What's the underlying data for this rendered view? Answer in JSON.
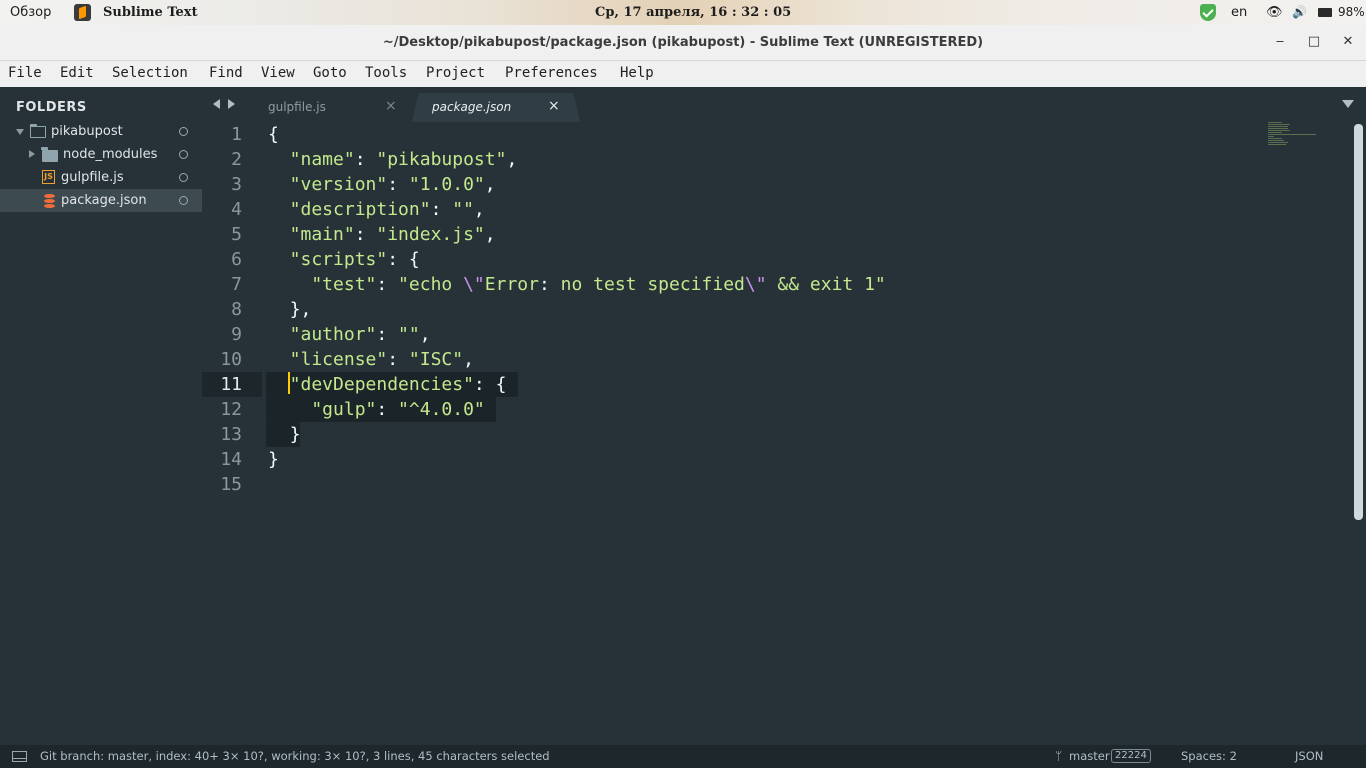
{
  "topbar": {
    "overview": "Обзор",
    "app_name": "Sublime Text",
    "clock": "Ср, 17 апреля, 16 : 32 : 05",
    "language": "en",
    "battery": "98%"
  },
  "window": {
    "title": "~/Desktop/pikabupost/package.json (pikabupost) - Sublime Text (UNREGISTERED)",
    "minimize": "‒",
    "maximize": "□",
    "close": "✕"
  },
  "menu": [
    "File",
    "Edit",
    "Selection",
    "Find",
    "View",
    "Goto",
    "Tools",
    "Project",
    "Preferences",
    "Help"
  ],
  "sidebar": {
    "heading": "FOLDERS",
    "items": [
      {
        "label": "pikabupost",
        "type": "folder-open"
      },
      {
        "label": "node_modules",
        "type": "folder"
      },
      {
        "label": "gulpfile.js",
        "type": "js"
      },
      {
        "label": "package.json",
        "type": "json"
      }
    ]
  },
  "tabs": [
    {
      "label": "gulpfile.js",
      "active": false
    },
    {
      "label": "package.json",
      "active": true
    }
  ],
  "editor": {
    "current_line": 11,
    "line_numbers": [
      "1",
      "2",
      "3",
      "4",
      "5",
      "6",
      "7",
      "8",
      "9",
      "10",
      "11",
      "12",
      "13",
      "14",
      "15"
    ],
    "code_lines": [
      "{",
      "  \"name\": \"pikabupost\",",
      "  \"version\": \"1.0.0\",",
      "  \"description\": \"\",",
      "  \"main\": \"index.js\",",
      "  \"scripts\": {",
      "    \"test\": \"echo \\\"Error: no test specified\\\" && exit 1\"",
      "  },",
      "  \"author\": \"\",",
      "  \"license\": \"ISC\",",
      "  \"devDependencies\": {",
      "    \"gulp\": \"^4.0.0\"",
      "  }",
      "}",
      ""
    ]
  },
  "statusbar": {
    "git_info": "Git branch: master, index: 40+ 3× 10?, working: 3× 10?, 3 lines, 45 characters selected",
    "branch": "master",
    "branch_count": "22224",
    "spaces": "Spaces: 2",
    "syntax": "JSON"
  },
  "colors": {
    "background": "#263238",
    "string": "#c3e88d",
    "punctuation": "#eeffff",
    "escape": "#c792ea",
    "caret": "#ffcc00"
  }
}
